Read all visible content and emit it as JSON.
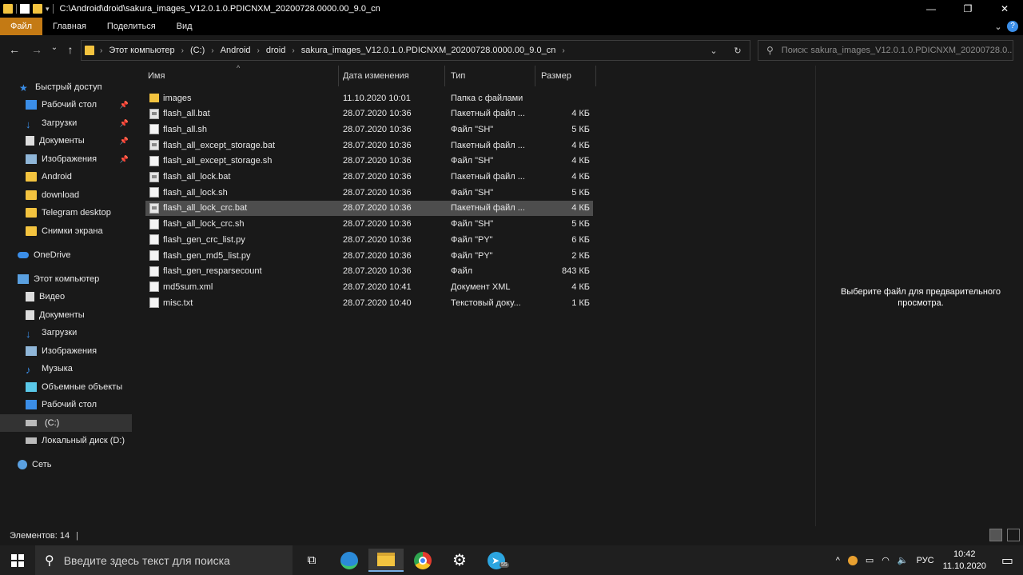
{
  "window": {
    "title": "C:\\Android\\droid\\sakura_images_V12.0.1.0.PDICNXM_20200728.0000.00_9.0_cn",
    "controls": {
      "minimize": "—",
      "maximize": "❐",
      "close": "✕"
    }
  },
  "ribbon": {
    "tabs": [
      "Файл",
      "Главная",
      "Поделиться",
      "Вид"
    ],
    "collapse_glyph": "⌄",
    "help_glyph": "?"
  },
  "nav": {
    "back": "←",
    "forward": "→",
    "recent": "⌄",
    "up": "↑"
  },
  "address": {
    "crumbs": [
      "Этот компьютер",
      "(C:)",
      "Android",
      "droid",
      "sakura_images_V12.0.1.0.PDICNXM_20200728.0000.00_9.0_cn"
    ],
    "chevron": "›",
    "dropdown": "⌄",
    "refresh": "↻"
  },
  "search": {
    "placeholder": "Поиск: sakura_images_V12.0.1.0.PDICNXM_20200728.0..."
  },
  "sidebar": {
    "quick_access": "Быстрый доступ",
    "quick_items": [
      {
        "label": "Рабочий стол",
        "pinned": true
      },
      {
        "label": "Загрузки",
        "pinned": true
      },
      {
        "label": "Документы",
        "pinned": true
      },
      {
        "label": "Изображения",
        "pinned": true
      },
      {
        "label": "Android"
      },
      {
        "label": "download"
      },
      {
        "label": "Telegram desktop"
      },
      {
        "label": "Снимки экрана"
      }
    ],
    "onedrive": "OneDrive",
    "this_pc": "Этот компьютер",
    "pc_items": [
      {
        "label": "Видео"
      },
      {
        "label": "Документы"
      },
      {
        "label": "Загрузки"
      },
      {
        "label": "Изображения"
      },
      {
        "label": "Музыка"
      },
      {
        "label": "Объемные объекты"
      },
      {
        "label": "Рабочий стол"
      },
      {
        "label": "(C:)"
      },
      {
        "label": "Локальный диск (D:)"
      }
    ],
    "network": "Сеть"
  },
  "columns": {
    "name": "Имя",
    "date": "Дата изменения",
    "type": "Тип",
    "size": "Размер",
    "sort_glyph": "^"
  },
  "files": [
    {
      "name": "images",
      "date": "11.10.2020 10:01",
      "type": "Папка с файлами",
      "size": "",
      "kind": "folder"
    },
    {
      "name": "flash_all.bat",
      "date": "28.07.2020 10:36",
      "type": "Пакетный файл ...",
      "size": "4 КБ",
      "kind": "bat"
    },
    {
      "name": "flash_all.sh",
      "date": "28.07.2020 10:36",
      "type": "Файл \"SH\"",
      "size": "5 КБ",
      "kind": "doc"
    },
    {
      "name": "flash_all_except_storage.bat",
      "date": "28.07.2020 10:36",
      "type": "Пакетный файл ...",
      "size": "4 КБ",
      "kind": "bat"
    },
    {
      "name": "flash_all_except_storage.sh",
      "date": "28.07.2020 10:36",
      "type": "Файл \"SH\"",
      "size": "4 КБ",
      "kind": "doc"
    },
    {
      "name": "flash_all_lock.bat",
      "date": "28.07.2020 10:36",
      "type": "Пакетный файл ...",
      "size": "4 КБ",
      "kind": "bat"
    },
    {
      "name": "flash_all_lock.sh",
      "date": "28.07.2020 10:36",
      "type": "Файл \"SH\"",
      "size": "5 КБ",
      "kind": "doc"
    },
    {
      "name": "flash_all_lock_crc.bat",
      "date": "28.07.2020 10:36",
      "type": "Пакетный файл ...",
      "size": "4 КБ",
      "kind": "bat",
      "selected": true
    },
    {
      "name": "flash_all_lock_crc.sh",
      "date": "28.07.2020 10:36",
      "type": "Файл \"SH\"",
      "size": "5 КБ",
      "kind": "doc"
    },
    {
      "name": "flash_gen_crc_list.py",
      "date": "28.07.2020 10:36",
      "type": "Файл \"PY\"",
      "size": "6 КБ",
      "kind": "doc"
    },
    {
      "name": "flash_gen_md5_list.py",
      "date": "28.07.2020 10:36",
      "type": "Файл \"PY\"",
      "size": "2 КБ",
      "kind": "doc"
    },
    {
      "name": "flash_gen_resparsecount",
      "date": "28.07.2020 10:36",
      "type": "Файл",
      "size": "843 КБ",
      "kind": "doc"
    },
    {
      "name": "md5sum.xml",
      "date": "28.07.2020 10:41",
      "type": "Документ XML",
      "size": "4 КБ",
      "kind": "doc"
    },
    {
      "name": "misc.txt",
      "date": "28.07.2020 10:40",
      "type": "Текстовый доку...",
      "size": "1 КБ",
      "kind": "doc"
    }
  ],
  "preview": {
    "line1": "Выберите файл для предварительного",
    "line2": "просмотра."
  },
  "status": {
    "items": "Элементов: 14",
    "sep": "|"
  },
  "taskbar": {
    "search_placeholder": "Введите здесь текст для поиска",
    "search_glyph": "⚲",
    "lang": "РУС",
    "time": "10:42",
    "date": "11.10.2020",
    "tray_up": "^",
    "notif_glyph": "▭",
    "gear_glyph": "⚙",
    "telegram_badge": "55"
  },
  "colors": {
    "accent": "#c47a14",
    "folder": "#f3c33f",
    "link_blue": "#3b8ee8"
  }
}
